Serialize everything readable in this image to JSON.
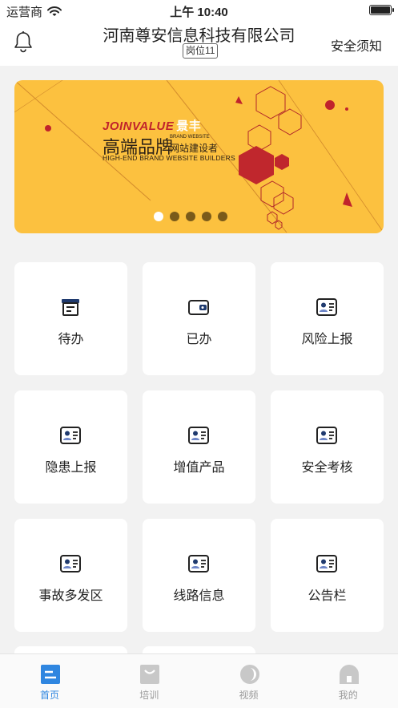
{
  "status_bar": {
    "carrier": "运营商",
    "time": "上午 10:40",
    "battery_level": 1.0
  },
  "header": {
    "title": "河南尊安信息科技有限公司",
    "post_badge": "岗位11",
    "notice_link": "安全须知"
  },
  "banner": {
    "brand_en": "JOINVALUE",
    "brand_cn": "景丰",
    "headline": "高端品牌",
    "sub_en_top": "BRAND WEBSITE",
    "sub_cn": "网站建设者",
    "sub_en": "HIGH-END BRAND WEBSITE BUILDERS",
    "slide_count": 5,
    "active_slide": 1
  },
  "grid_items": [
    {
      "label": "待办",
      "icon": "archive-icon"
    },
    {
      "label": "已办",
      "icon": "wallet-icon"
    },
    {
      "label": "风险上报",
      "icon": "id-card-icon"
    },
    {
      "label": "隐患上报",
      "icon": "id-card-icon"
    },
    {
      "label": "增值产品",
      "icon": "id-card-icon"
    },
    {
      "label": "安全考核",
      "icon": "id-card-icon"
    },
    {
      "label": "事故多发区",
      "icon": "id-card-icon"
    },
    {
      "label": "线路信息",
      "icon": "id-card-icon"
    },
    {
      "label": "公告栏",
      "icon": "id-card-icon"
    }
  ],
  "tabs": [
    {
      "label": "首页",
      "icon": "home-icon",
      "active": true
    },
    {
      "label": "培训",
      "icon": "training-icon",
      "active": false
    },
    {
      "label": "视频",
      "icon": "video-icon",
      "active": false
    },
    {
      "label": "我的",
      "icon": "profile-icon",
      "active": false
    }
  ],
  "colors": {
    "accent": "#2f86e0",
    "banner_bg": "#fcc13f",
    "brand_red": "#c0232c",
    "page_bg": "#f2f2f2"
  }
}
